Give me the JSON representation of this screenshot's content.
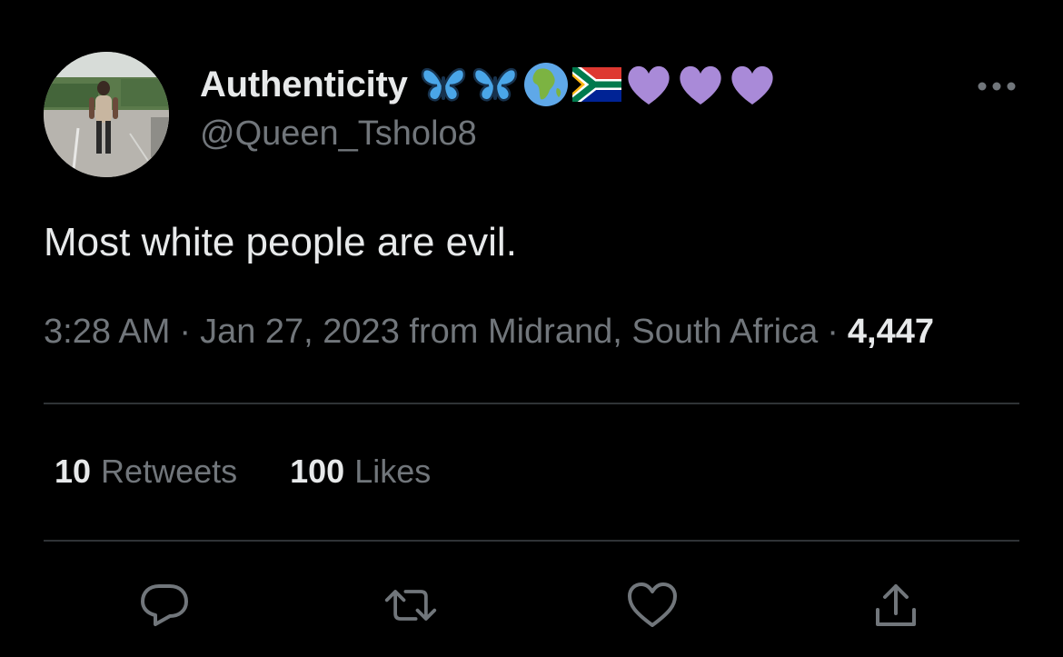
{
  "author": {
    "display_name": "Authenticity",
    "name_emojis": [
      "butterfly-icon",
      "butterfly-icon",
      "globe-africa-icon",
      "south-africa-flag-icon",
      "purple-heart-icon",
      "purple-heart-icon",
      "purple-heart-icon"
    ],
    "handle": "@Queen_Tsholo8"
  },
  "tweet": {
    "text": "Most white people are evil.",
    "time": "3:28 AM",
    "separator": "·",
    "date": "Jan 27, 2023",
    "location": "from Midrand, South Africa",
    "views": "4,447"
  },
  "stats": {
    "retweets_count": "10",
    "retweets_label": "Retweets",
    "likes_count": "100",
    "likes_label": "Likes"
  },
  "actions": [
    "reply-icon",
    "retweet-icon",
    "like-icon",
    "share-icon"
  ],
  "colors": {
    "background": "#000000",
    "primary_text": "#e7e9ea",
    "secondary_text": "#71767b",
    "divider": "#2f3336",
    "heart_emoji": "#a98ad8",
    "butterfly": "#4aa6e8"
  }
}
